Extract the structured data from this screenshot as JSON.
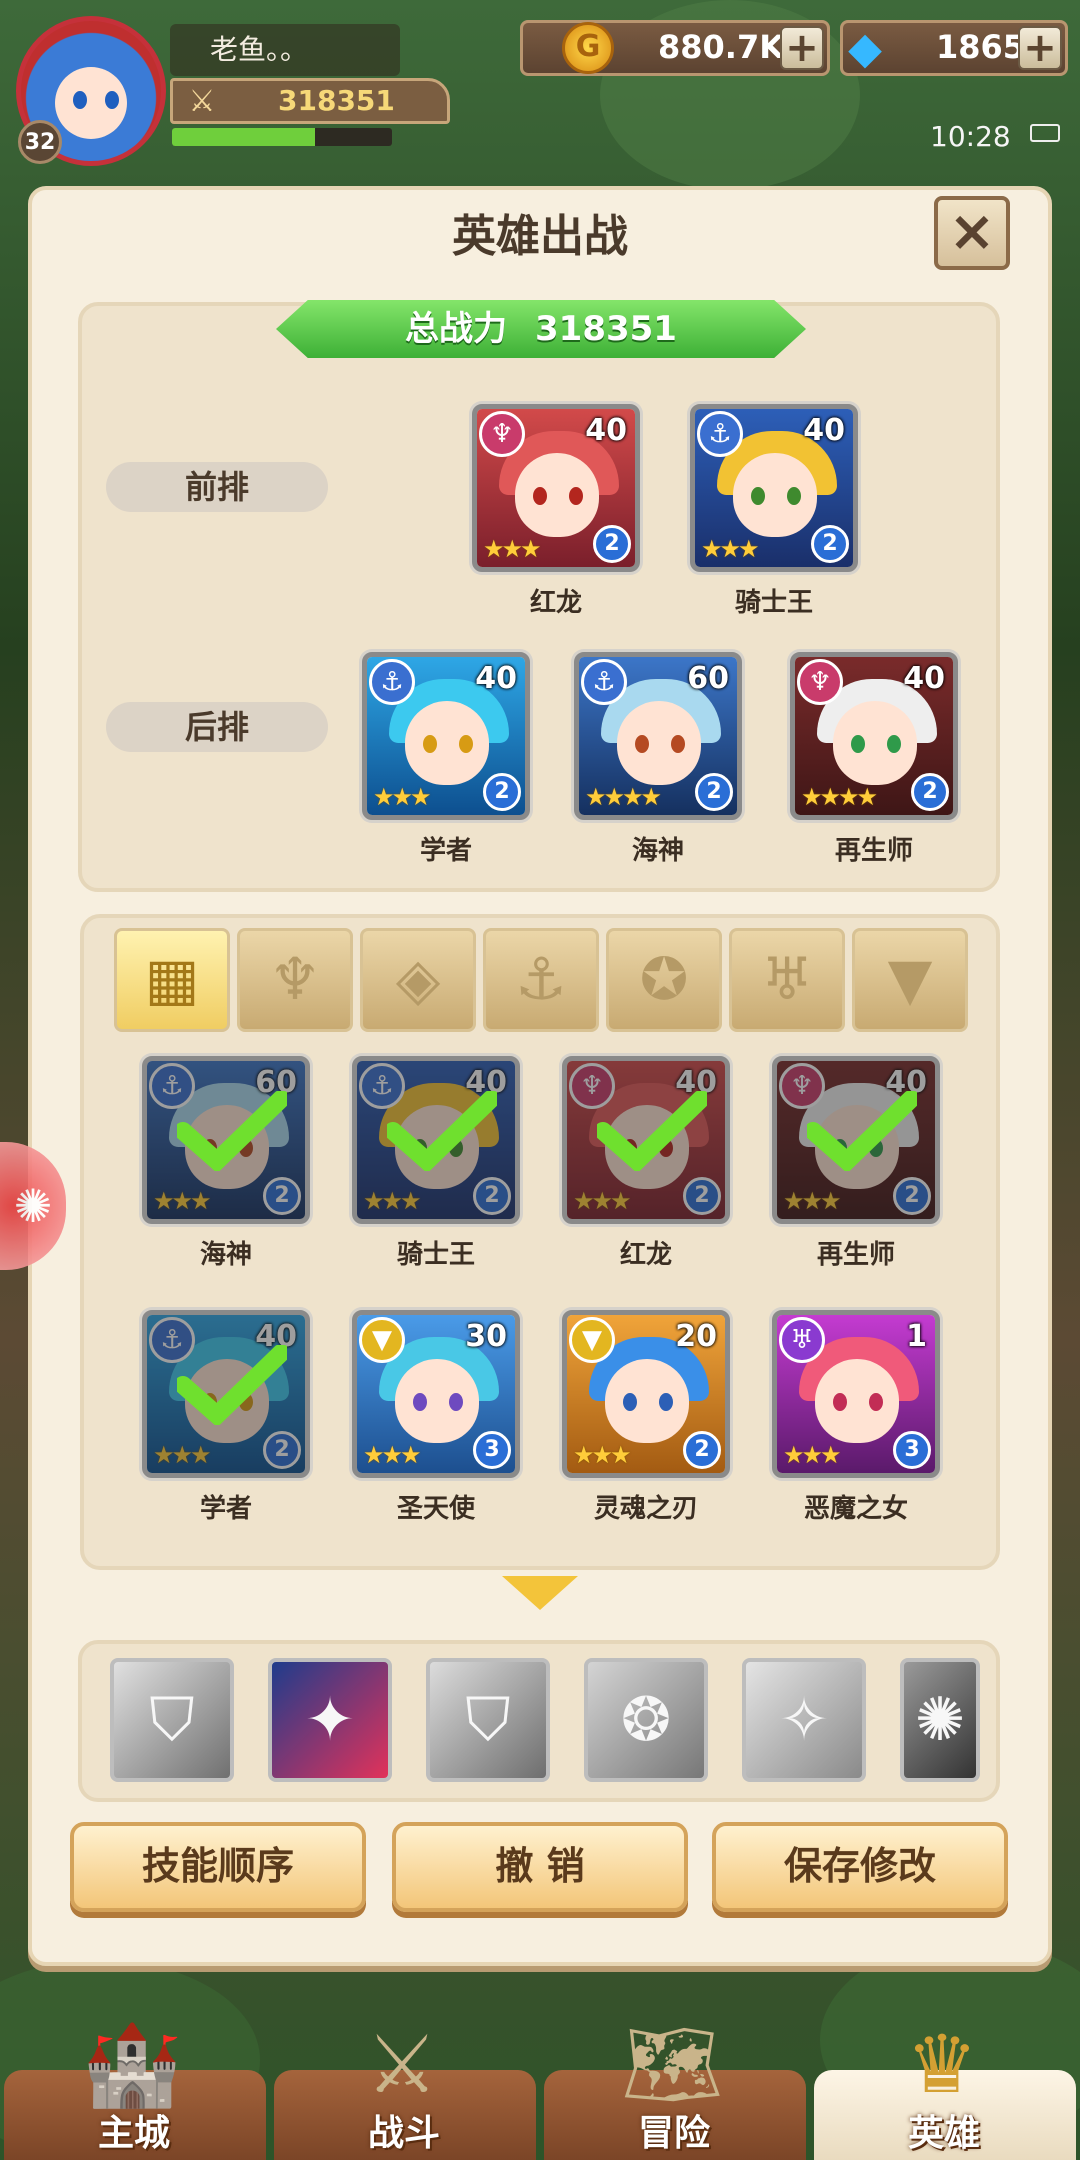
{
  "player": {
    "name": "老鱼。。",
    "level": "32",
    "power": "318351",
    "xp_fraction": 0.65
  },
  "currency": {
    "gold": "880.7K",
    "gems": "1865",
    "add": "+"
  },
  "status": {
    "time": "10:28"
  },
  "panel": {
    "title": "英雄出战",
    "close": "×"
  },
  "total_power": {
    "label": "总战力",
    "value": "318351"
  },
  "rows": {
    "front": "前排",
    "back": "后排"
  },
  "front_heroes": [
    {
      "name": "红龙",
      "level": "40",
      "grade": "2",
      "stars": "★★★",
      "faction": "fire",
      "faction_glyph": "♆",
      "palette": "red"
    },
    {
      "name": "骑士王",
      "level": "40",
      "grade": "2",
      "stars": "★★★",
      "faction": "anchor",
      "faction_glyph": "⚓",
      "palette": "gold"
    }
  ],
  "back_heroes": [
    {
      "name": "学者",
      "level": "40",
      "grade": "2",
      "stars": "★★★",
      "faction": "anchor",
      "faction_glyph": "⚓",
      "palette": "cyan"
    },
    {
      "name": "海神",
      "level": "60",
      "grade": "2",
      "stars": "★★★★",
      "faction": "anchor",
      "faction_glyph": "⚓",
      "palette": "ice"
    },
    {
      "name": "再生师",
      "level": "40",
      "grade": "2",
      "stars": "★★★★",
      "faction": "fire",
      "faction_glyph": "♆",
      "palette": "white"
    }
  ],
  "filters": [
    {
      "name": "all",
      "glyph": "▦"
    },
    {
      "name": "fire",
      "glyph": "♆"
    },
    {
      "name": "diamond",
      "glyph": "◈"
    },
    {
      "name": "anchor",
      "glyph": "⚓"
    },
    {
      "name": "beast",
      "glyph": "✪"
    },
    {
      "name": "demon",
      "glyph": "♅"
    },
    {
      "name": "wing",
      "glyph": "▼"
    }
  ],
  "roster": [
    {
      "name": "海神",
      "level": "60",
      "grade": "2",
      "stars": "★★★",
      "faction": "anchor",
      "faction_glyph": "⚓",
      "palette": "ice",
      "selected": true
    },
    {
      "name": "骑士王",
      "level": "40",
      "grade": "2",
      "stars": "★★★",
      "faction": "anchor",
      "faction_glyph": "⚓",
      "palette": "gold",
      "selected": true
    },
    {
      "name": "红龙",
      "level": "40",
      "grade": "2",
      "stars": "★★★",
      "faction": "fire",
      "faction_glyph": "♆",
      "palette": "red",
      "selected": true
    },
    {
      "name": "再生师",
      "level": "40",
      "grade": "2",
      "stars": "★★★",
      "faction": "fire",
      "faction_glyph": "♆",
      "palette": "white",
      "selected": true
    },
    {
      "name": "学者",
      "level": "40",
      "grade": "2",
      "stars": "★★★",
      "faction": "anchor",
      "faction_glyph": "⚓",
      "palette": "cyan",
      "selected": true
    },
    {
      "name": "圣天使",
      "level": "30",
      "grade": "3",
      "stars": "★★★",
      "faction": "light",
      "faction_glyph": "▼",
      "palette": "angel",
      "selected": false
    },
    {
      "name": "灵魂之刃",
      "level": "20",
      "grade": "2",
      "stars": "★★★",
      "faction": "light",
      "faction_glyph": "▼",
      "palette": "blue",
      "selected": false
    },
    {
      "name": "恶魔之女",
      "level": "1",
      "grade": "3",
      "stars": "★★★",
      "faction": "demon",
      "faction_glyph": "♅",
      "palette": "pink",
      "selected": false
    }
  ],
  "skills": [
    {
      "name": "shield-skill",
      "glyph": "⛉"
    },
    {
      "name": "water-skill",
      "glyph": "✦"
    },
    {
      "name": "shield-skill-2",
      "glyph": "⛉"
    },
    {
      "name": "wave-skill",
      "glyph": "❂"
    },
    {
      "name": "claw-skill",
      "glyph": "✧"
    },
    {
      "name": "dark-skill",
      "glyph": "✺"
    }
  ],
  "buttons": {
    "order": "技能顺序",
    "undo": "撤 销",
    "save": "保存修改"
  },
  "nav": [
    {
      "label": "主城",
      "icon": "city-icon",
      "glyph": "🏰"
    },
    {
      "label": "战斗",
      "icon": "swords-icon",
      "glyph": "⚔"
    },
    {
      "label": "冒险",
      "icon": "map-icon",
      "glyph": "🗺"
    },
    {
      "label": "英雄",
      "icon": "hero-icon",
      "glyph": "♛"
    }
  ]
}
